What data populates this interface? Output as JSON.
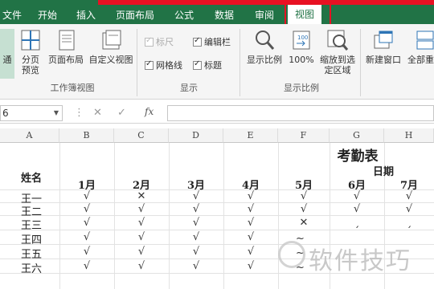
{
  "ribbon_tabs": [
    {
      "label": "文件"
    },
    {
      "label": "开始"
    },
    {
      "label": "插入"
    },
    {
      "label": "页面布局"
    },
    {
      "label": "公式"
    },
    {
      "label": "数据"
    },
    {
      "label": "审阅"
    },
    {
      "label": "视图"
    }
  ],
  "active_tab": "视图",
  "groups": {
    "workbook_views": {
      "label": "工作簿视图",
      "normal": "普通",
      "page_break": "分页预览",
      "page_layout": "页面布局",
      "custom_views": "自定义视图"
    },
    "show": {
      "label": "显示",
      "ruler": "标尺",
      "formula_bar": "编辑栏",
      "gridlines": "网格线",
      "headings": "标题"
    },
    "zoom": {
      "label": "显示比例",
      "zoom": "显示比例",
      "zoom_100": "100%",
      "zoom_selection": "缩放到选定区域"
    },
    "window": {
      "new_window": "新建窗口",
      "arrange_all": "全部重排"
    }
  },
  "formula_bar": {
    "name_box": "6",
    "cancel": "✕",
    "enter": "✓",
    "fx": "fx",
    "content": ""
  },
  "columns": [
    "A",
    "B",
    "C",
    "D",
    "E",
    "F",
    "G",
    "H"
  ],
  "sheet": {
    "title": "考勤表",
    "date_label": "日期",
    "name_header": "姓名",
    "months": [
      "1月",
      "2月",
      "3月",
      "4月",
      "5月",
      "6月",
      "7月"
    ],
    "rows": [
      {
        "name": "王一",
        "marks": [
          "√",
          "✕",
          "√",
          "√",
          "√",
          "√",
          "√"
        ]
      },
      {
        "name": "王二",
        "marks": [
          "√",
          "√",
          "√",
          "√",
          "√",
          "√",
          "√"
        ]
      },
      {
        "name": "王三",
        "marks": [
          "√",
          "√",
          "√",
          "√",
          "✕",
          "ˏ",
          "ˏ"
        ]
      },
      {
        "name": "王四",
        "marks": [
          "√",
          "√",
          "√",
          "√",
          "~",
          "",
          ""
        ]
      },
      {
        "name": "王五",
        "marks": [
          "√",
          "√",
          "√",
          "√",
          "~",
          "",
          ""
        ]
      },
      {
        "name": "王六",
        "marks": [
          "√",
          "√",
          "√",
          "√",
          "~",
          "",
          ""
        ]
      }
    ]
  },
  "watermark": "软件技巧",
  "colors": {
    "excel_green": "#217346",
    "highlight_red": "#e81123"
  }
}
